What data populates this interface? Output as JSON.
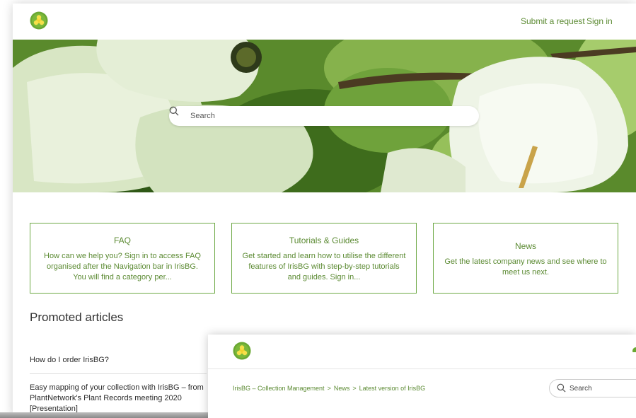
{
  "header": {
    "nav": {
      "submit_request": "Submit a request",
      "sign_in": "Sign in"
    }
  },
  "hero": {
    "search": {
      "placeholder": "Search"
    }
  },
  "cards": [
    {
      "title": "FAQ",
      "description": "How can we help you? Sign in to access FAQ organised after the Navigation bar in IrisBG. You will find a category per..."
    },
    {
      "title": "Tutorials & Guides",
      "description": "Get started and learn how to utilise the different features of IrisBG with step-by-step tutorials and guides. Sign in..."
    },
    {
      "title": "News",
      "description": "Get the latest company news and see where to meet us next."
    }
  ],
  "promoted": {
    "heading": "Promoted articles",
    "articles": [
      "How do I order IrisBG?",
      "Easy mapping of your collection with IrisBG – from PlantNetwork's Plant Records meeting 2020 [Presentation]"
    ]
  },
  "second_window": {
    "breadcrumb": [
      "IrisBG – Collection Management",
      "News",
      "Latest version of IrisBG"
    ],
    "breadcrumb_separator": ">",
    "search": {
      "placeholder": "Search"
    }
  },
  "colors": {
    "accent_green": "#5b8a32",
    "card_border": "#6ea946",
    "logo_green": "#6aa832",
    "logo_yellow": "#f2d12e"
  },
  "icons": {
    "logo": "irisbg-logo-icon",
    "search": "search-icon"
  }
}
